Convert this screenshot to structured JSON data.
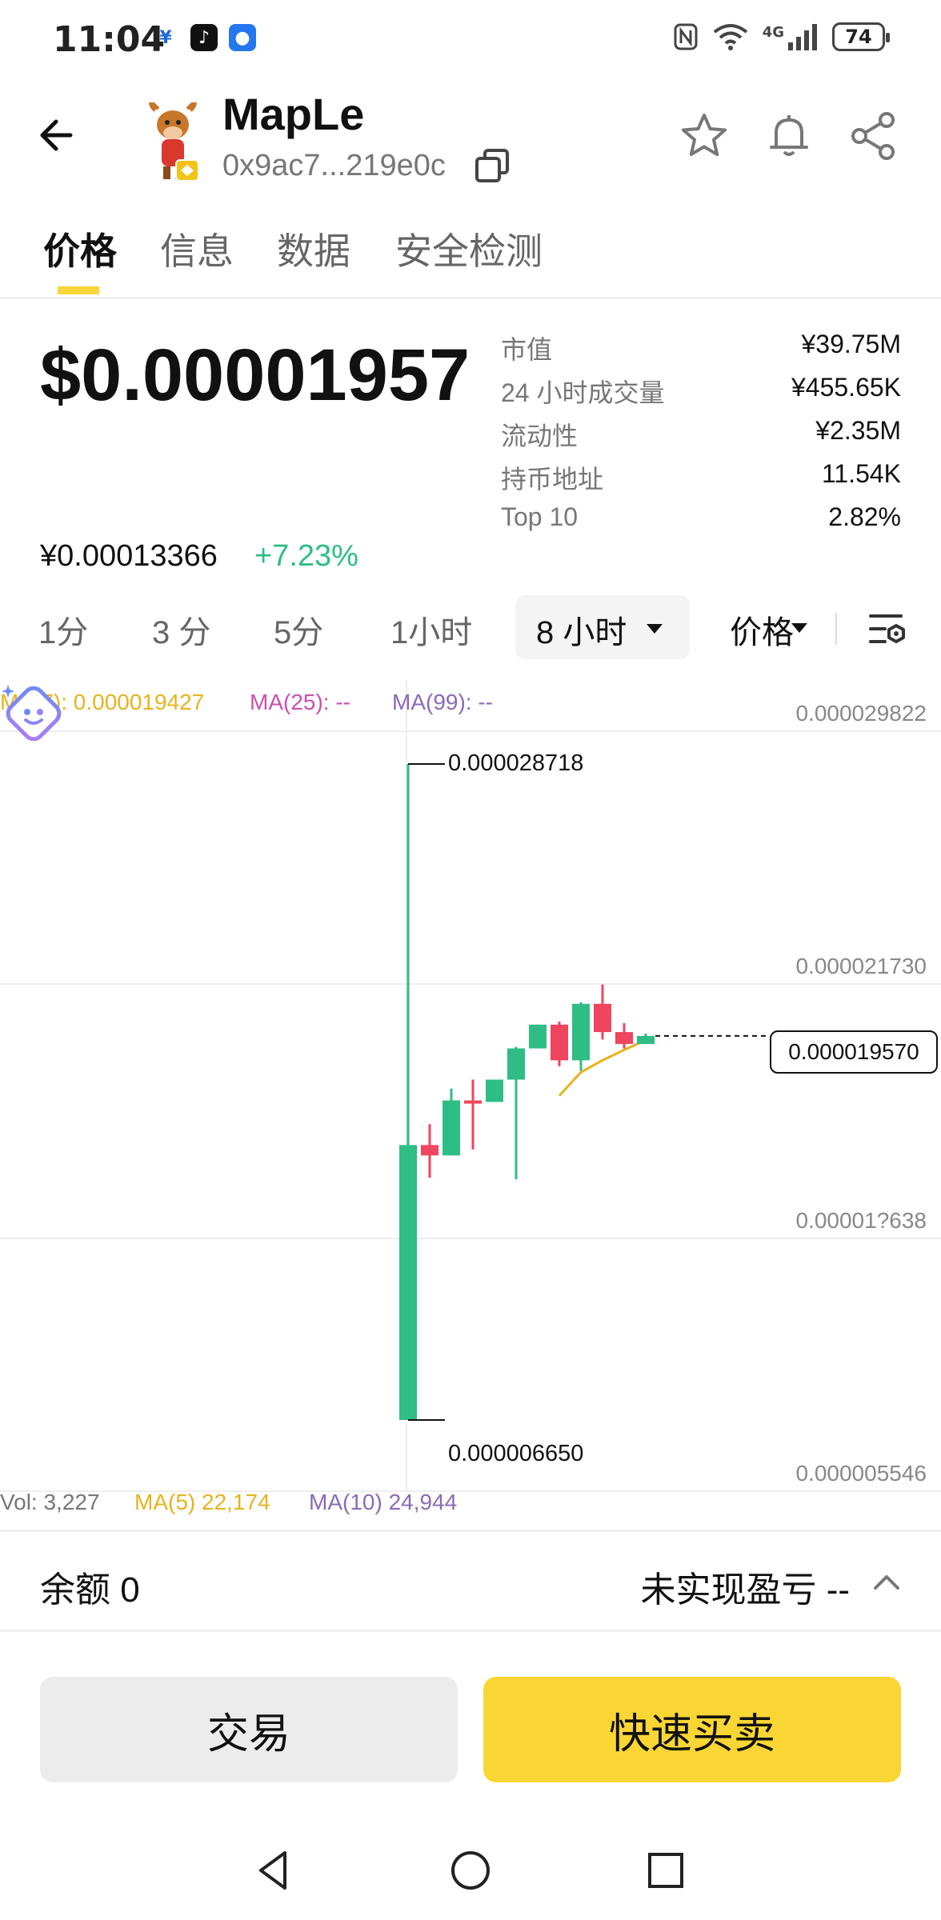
{
  "status_bar": {
    "time": "11:04",
    "icons": [
      "yen-app-icon",
      "tiktok-icon",
      "bulb-app-icon"
    ],
    "network": "4G",
    "battery": "74"
  },
  "header": {
    "token_name": "MapLe",
    "address": "0x9ac7...219e0c"
  },
  "tabs": [
    "价格",
    "信息",
    "数据",
    "安全检测"
  ],
  "price": {
    "usd": "$0.00001957",
    "cny": "¥0.00013366",
    "change": "+7.23%",
    "change_color": "#2ebd85"
  },
  "stats": [
    {
      "label": "市值",
      "value": "¥39.75M"
    },
    {
      "label": "24 小时成交量",
      "value": "¥455.65K"
    },
    {
      "label": "流动性",
      "value": "¥2.35M"
    },
    {
      "label": "持币地址",
      "value": "11.54K"
    },
    {
      "label": "Top 10",
      "value": "2.82%"
    }
  ],
  "intervals": {
    "options": [
      "1分",
      "3 分",
      "5分",
      "1小时"
    ],
    "selected": "8 小时",
    "chart_mode": "价格"
  },
  "chart": {
    "ma_indicators": [
      {
        "label": "MA(7): 0.000019427",
        "color": "#e5b41f"
      },
      {
        "label": "MA(25): --",
        "color": "#cc4fae"
      },
      {
        "label": "MA(99): --",
        "color": "#8a6ab8"
      }
    ],
    "y_axis_labels": [
      "0.000029822",
      "0.000021730",
      "0.00001?638",
      "0.000005546"
    ],
    "high_marker": "0.000028718",
    "low_marker": "0.000006650",
    "current_price": "0.000019570",
    "volume": [
      {
        "label": "Vol: 3,227",
        "color": "#777777"
      },
      {
        "label": "MA(5) 22,174",
        "color": "#e5b41f"
      },
      {
        "label": "MA(10) 24,944",
        "color": "#8a6ab8"
      }
    ],
    "up_color": "#2ebd85",
    "down_color": "#f0455e"
  },
  "chart_data": {
    "type": "candlestick",
    "ylim": [
      5.546e-06,
      2.9822e-05
    ],
    "candles": [
      {
        "o": 6.65e-06,
        "h": 2.8718e-05,
        "l": 6.65e-06,
        "c": 1.59e-05
      },
      {
        "o": 1.59e-05,
        "h": 1.66e-05,
        "l": 1.48e-05,
        "c": 1.555e-05
      },
      {
        "o": 1.555e-05,
        "h": 1.78e-05,
        "l": 1.555e-05,
        "c": 1.74e-05
      },
      {
        "o": 1.74e-05,
        "h": 1.81e-05,
        "l": 1.575e-05,
        "c": 1.735e-05
      },
      {
        "o": 1.735e-05,
        "h": 1.81e-05,
        "l": 1.735e-05,
        "c": 1.81e-05
      },
      {
        "o": 1.81e-05,
        "h": 1.92e-05,
        "l": 1.475e-05,
        "c": 1.915e-05
      },
      {
        "o": 1.915e-05,
        "h": 1.995e-05,
        "l": 1.915e-05,
        "c": 1.995e-05
      },
      {
        "o": 1.995e-05,
        "h": 2.005e-05,
        "l": 1.855e-05,
        "c": 1.875e-05
      },
      {
        "o": 1.875e-05,
        "h": 2.07e-05,
        "l": 1.84e-05,
        "c": 2.065e-05
      },
      {
        "o": 2.065e-05,
        "h": 2.13e-05,
        "l": 1.945e-05,
        "c": 1.97e-05
      },
      {
        "o": 1.97e-05,
        "h": 2e-05,
        "l": 1.915e-05,
        "c": 1.93e-05
      },
      {
        "o": 1.93e-05,
        "h": 1.965e-05,
        "l": 1.93e-05,
        "c": 1.957e-05
      }
    ],
    "ma7": [
      1.756e-05,
      1.835e-05,
      1.875e-05,
      1.91e-05,
      1.9427e-05
    ]
  },
  "balance": {
    "label": "余额 0",
    "pnl": "未实现盈亏 --"
  },
  "buttons": {
    "trade": "交易",
    "quick": "快速买卖"
  }
}
